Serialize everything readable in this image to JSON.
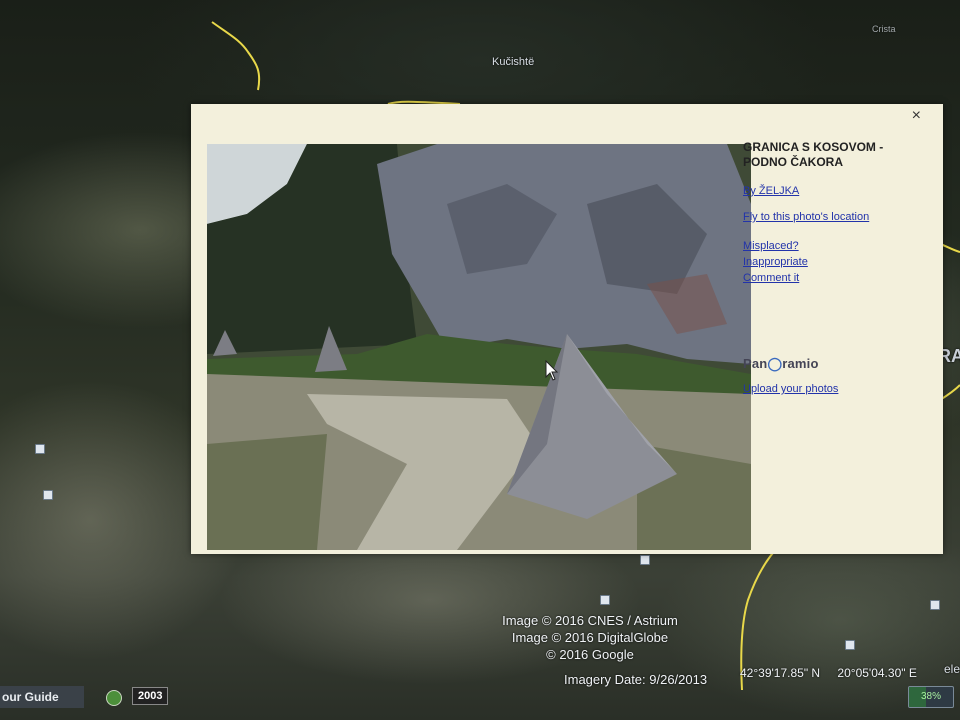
{
  "map": {
    "place_labels": [
      "Kučishtë",
      "Crista"
    ],
    "edge_label": "RA",
    "corner_label": "ele"
  },
  "popup": {
    "close_label": "×",
    "title": "GRANICA S KOSOVOM - PODNO ČAKORA",
    "author_link": "By ŽELJKA",
    "fly_link": "Fly to this photo's location",
    "misplaced_link": "Misplaced?",
    "inappropriate_link": "Inappropriate",
    "comment_link": "Comment it",
    "brand_prefix": "Pan",
    "brand_suffix": "ramio",
    "upload_link": "Upload your photos"
  },
  "attribution": {
    "line1": "Image © 2016 CNES / Astrium",
    "line2": "Image © 2016 DigitalGlobe",
    "line3": "© 2016 Google"
  },
  "status": {
    "imagery_date": "Imagery Date: 9/26/2013",
    "latitude": "42°39'17.85\" N",
    "longitude": "20°05'04.30\" E"
  },
  "controls": {
    "tour_guide": "our Guide",
    "year": "2003",
    "battery_percent": 38,
    "battery_label": "38%"
  },
  "colors": {
    "popup_bg": "#f3f0dc",
    "link": "#2233aa",
    "border_line": "#e8d84a"
  }
}
